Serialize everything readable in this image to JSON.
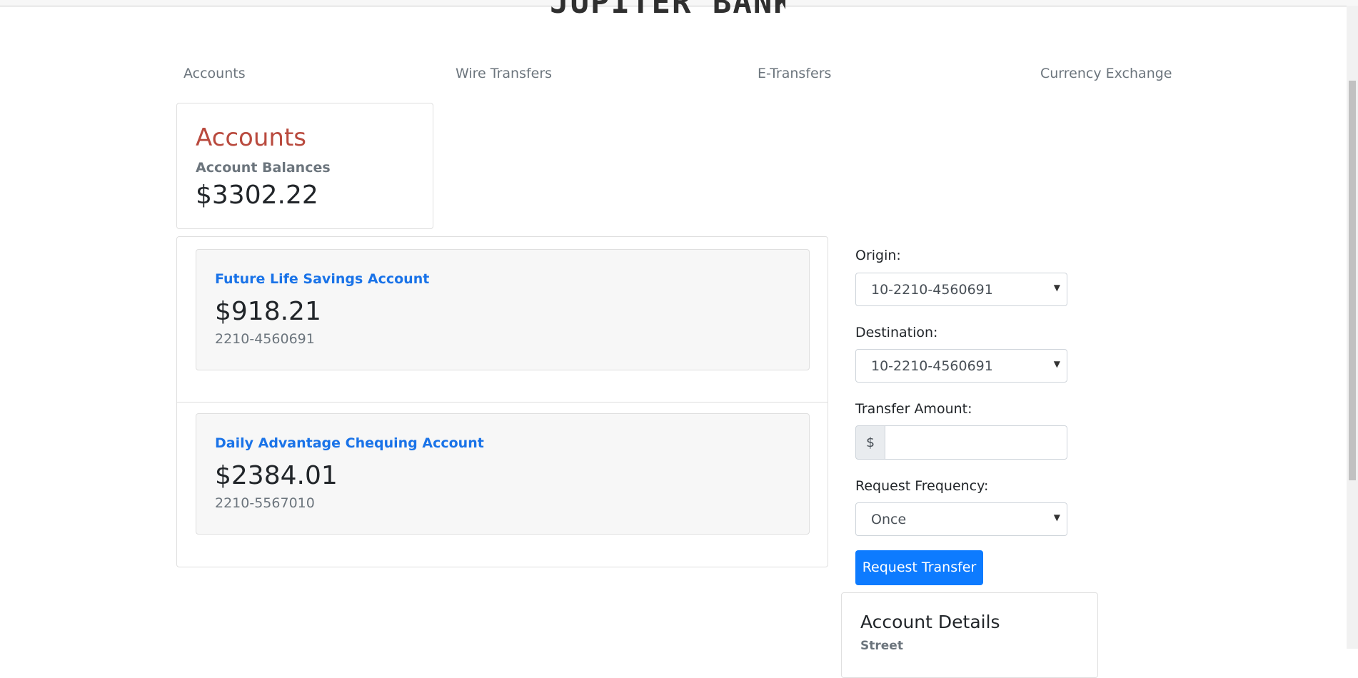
{
  "brand": {
    "logo_text": "JUPITER BANK"
  },
  "nav": {
    "items": [
      {
        "label": "Accounts"
      },
      {
        "label": "Wire Transfers"
      },
      {
        "label": "E-Transfers"
      },
      {
        "label": "Currency Exchange"
      }
    ]
  },
  "summary": {
    "title": "Accounts",
    "subtitle": "Account Balances",
    "total_balance": "$3302.22"
  },
  "accounts": [
    {
      "name": "Future Life Savings Account",
      "balance": "$918.21",
      "number": "2210-4560691"
    },
    {
      "name": "Daily Advantage Chequing Account",
      "balance": "$2384.01",
      "number": "2210-5567010"
    }
  ],
  "transfer_form": {
    "origin_label": "Origin:",
    "origin_value": "10-2210-4560691",
    "destination_label": "Destination:",
    "destination_value": "10-2210-4560691",
    "amount_label": "Transfer Amount:",
    "amount_prefix": "$",
    "amount_value": "",
    "frequency_label": "Request Frequency:",
    "frequency_value": "Once",
    "submit_label": "Request Transfer"
  },
  "account_details": {
    "title": "Account Details",
    "first_field_label": "Street"
  },
  "colors": {
    "accent_blue": "#0d7bff",
    "accounts_title_red": "#b94a3e",
    "link_blue": "#1a73e8"
  }
}
